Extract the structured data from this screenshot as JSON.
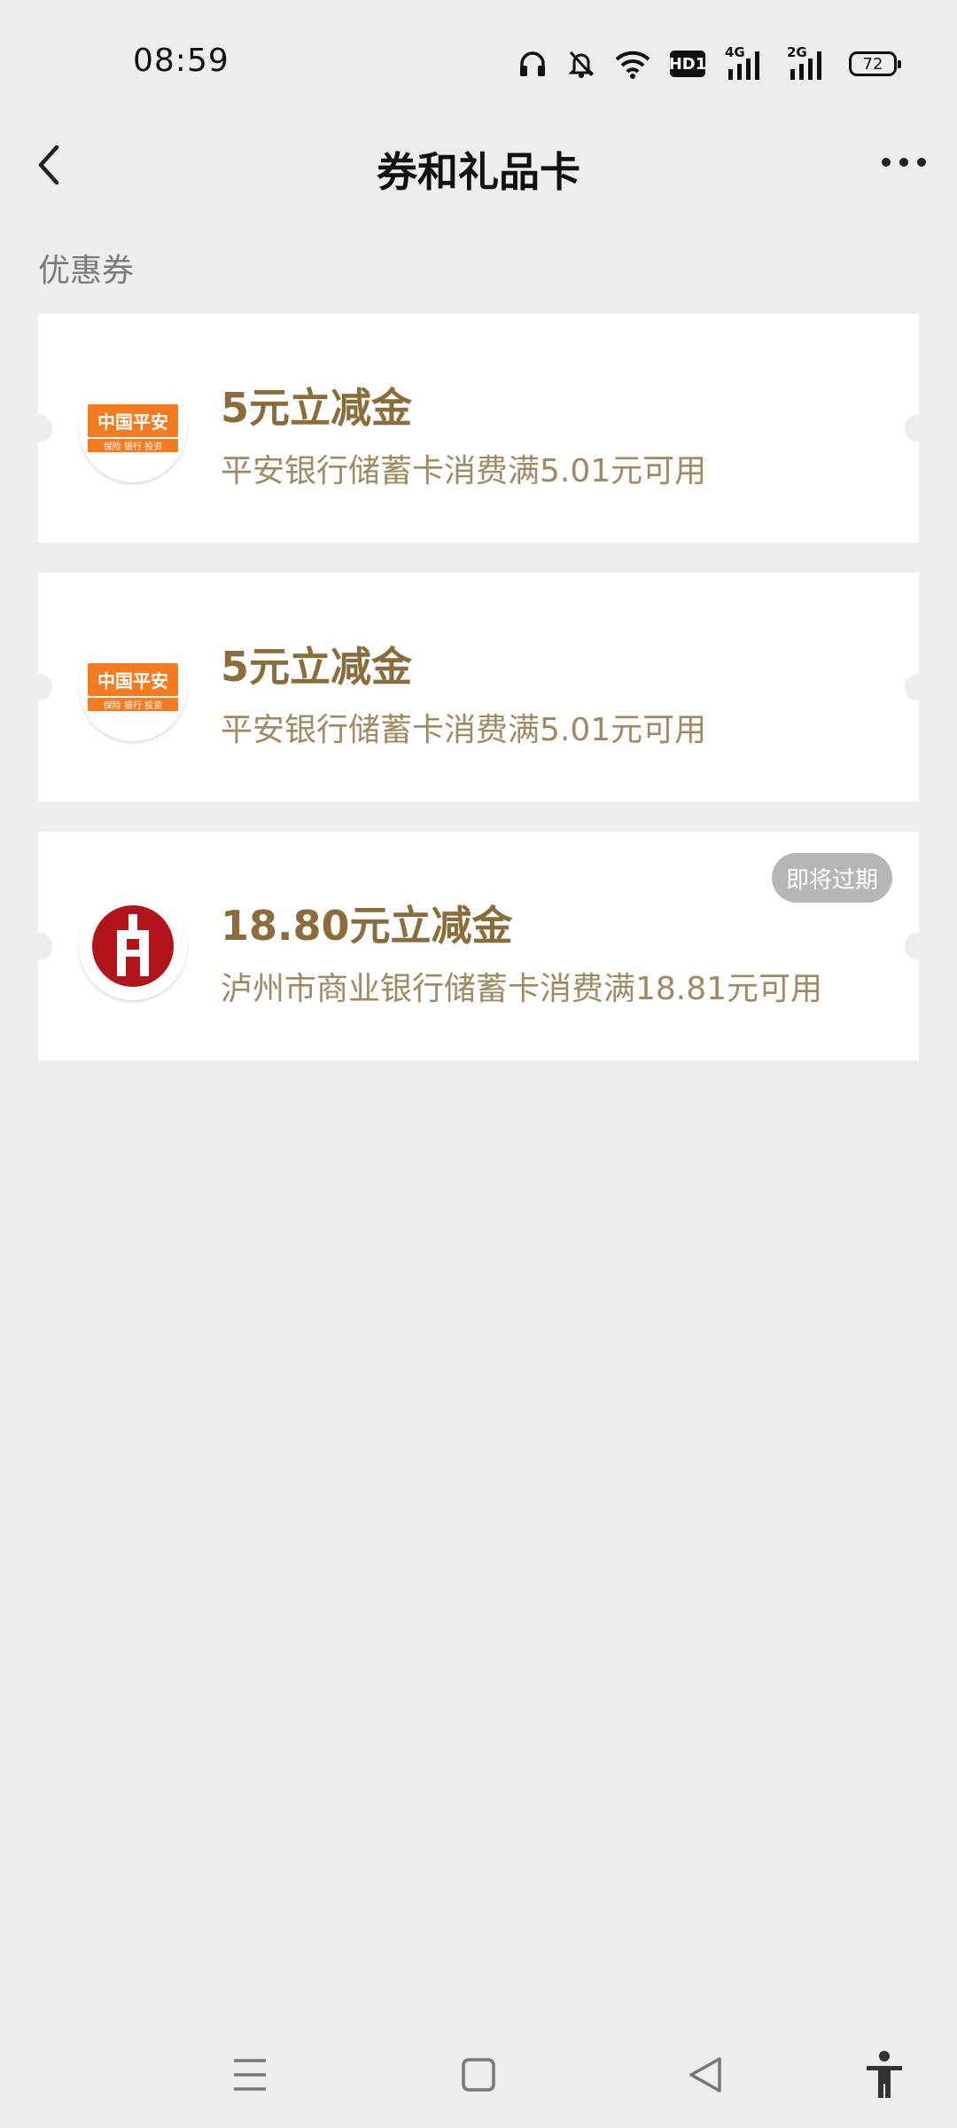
{
  "status_bar": {
    "time": "08:59",
    "battery": "72",
    "network1": "4G",
    "network2": "2G",
    "hd": "HD1"
  },
  "nav": {
    "title": "券和礼品卡"
  },
  "section": {
    "label": "优惠券"
  },
  "coupons": [
    {
      "bank_logo_text": "中国平安",
      "bank_logo_sub": "保险 银行 投资",
      "amount": "5元立减金",
      "desc": "平安银行储蓄卡消费满5.01元可用",
      "badge": ""
    },
    {
      "bank_logo_text": "中国平安",
      "bank_logo_sub": "保险 银行 投资",
      "amount": "5元立减金",
      "desc": "平安银行储蓄卡消费满5.01元可用",
      "badge": ""
    },
    {
      "amount": "18.80元立减金",
      "desc": "泸州市商业银行储蓄卡消费满18.81元可用",
      "badge": "即将过期"
    }
  ],
  "colors": {
    "background": "#ededed",
    "amount_text": "#8a6d3b",
    "desc_text": "#a08a63",
    "pingan_orange": "#f47b20",
    "luzhou_red": "#b3141b",
    "badge_bg": "#b6b6b6"
  },
  "icons": {
    "back": "chevron-left-icon",
    "more": "more-dots-icon",
    "sys_menu": "menu-lines-icon",
    "sys_home": "square-home-icon",
    "sys_back": "triangle-back-icon",
    "sys_accessibility": "accessibility-person-icon"
  }
}
